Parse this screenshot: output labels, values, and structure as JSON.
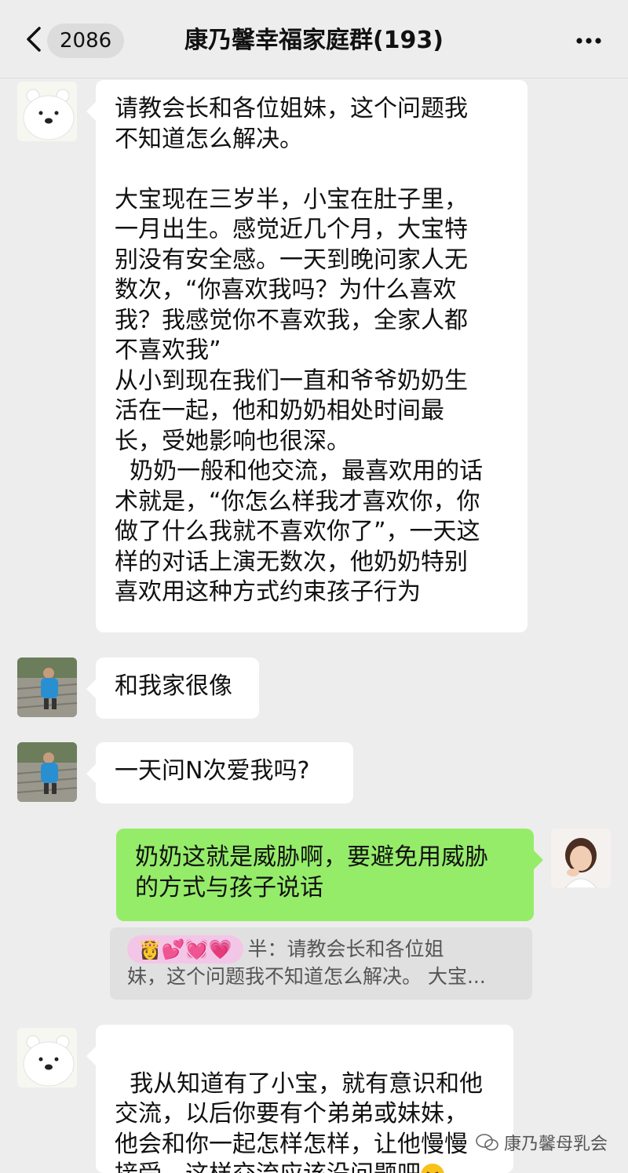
{
  "nav": {
    "back_count": "2086",
    "title": "康乃馨幸福家庭群(193)"
  },
  "messages": [
    {
      "text": "请教会长和各位姐妹，这个问题我\n不知道怎么解决。\n\n大宝现在三岁半，小宝在肚子里，\n一月出生。感觉近几个月，大宝特\n别没有安全感。一天到晚问家人无\n数次，“你喜欢我吗？为什么喜欢\n我？我感觉你不喜欢我，全家人都\n不喜欢我”\n从小到现在我们一直和爷爷奶奶生\n活在一起，他和奶奶相处时间最\n长，受她影响也很深。\n  奶奶一般和他交流，最喜欢用的话\n术就是，“你怎么样我才喜欢你，你\n做了什么我就不喜欢你了”，一天这\n样的对话上演无数次，他奶奶特别\n喜欢用这种方式约束孩子行为"
    },
    {
      "text": "和我家很像"
    },
    {
      "text": "一天问N次爱我吗?"
    },
    {
      "text": "奶奶这就是威胁啊，要避免用威胁\n的方式与孩子说话"
    },
    {
      "text": "我从知道有了小宝，就有意识和他\n交流，以后你要有个弟弟或妹妹，\n他会和你一起怎样怎样，让他慢慢\n接受。这样交流应该没问题吧"
    }
  ],
  "quote": {
    "emoji_name": "👸💕💓💗",
    "text_line1": "半：请教会长和各位姐",
    "text_line2": "妹，这个问题我不知道怎么解决。 大宝..."
  },
  "watermark": "康乃馨母乳会",
  "colors": {
    "background": "#ededed",
    "bubble_left": "#ffffff",
    "bubble_right": "#95ec69",
    "quote_bg": "#e0e0e0"
  },
  "icons": [
    "back-chevron-icon",
    "more-dots-icon",
    "polar-bear-avatar",
    "child-photo-avatar",
    "woman-photo-avatar",
    "laughing-tears-emoji",
    "wechat-logo-icon"
  ]
}
